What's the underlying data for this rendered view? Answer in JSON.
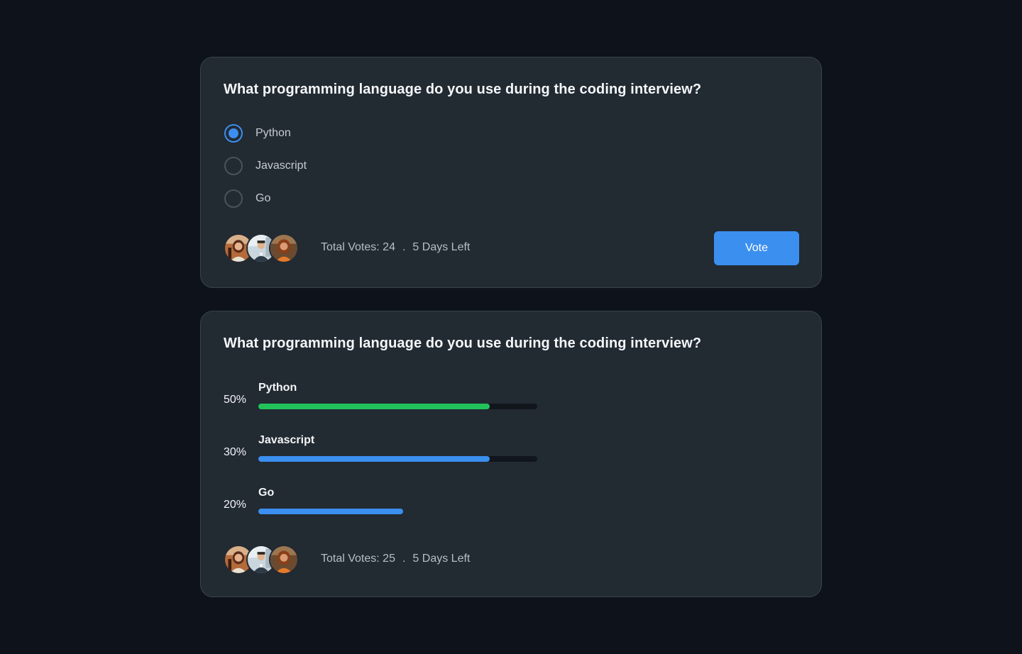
{
  "poll_vote": {
    "question": "What programming language do you use during the coding interview?",
    "options": [
      {
        "label": "Python",
        "selected": true
      },
      {
        "label": "Javascript",
        "selected": false
      },
      {
        "label": "Go",
        "selected": false
      }
    ],
    "total_votes": "Total Votes: 24",
    "separator": ".",
    "days_left": "5 Days Left",
    "vote_label": "Vote"
  },
  "poll_results": {
    "question": "What programming language do you use during the coding interview?",
    "results": [
      {
        "label": "Python",
        "percent_text": "50%",
        "bar_fill": 0.83,
        "color": "#22c25a"
      },
      {
        "label": "Javascript",
        "percent_text": "30%",
        "bar_fill": 0.83,
        "color": "#3b8fef"
      },
      {
        "label": "Go",
        "percent_text": "20%",
        "bar_fill": 0.52,
        "color": "#3b8fef",
        "track_visible": false
      }
    ],
    "total_votes": "Total Votes: 25",
    "separator": ".",
    "days_left": "5 Days Left"
  },
  "colors": {
    "background": "#0d121b",
    "card": "#222a32",
    "accent": "#3b8fef",
    "success": "#22c25a"
  },
  "icons": {
    "avatars": [
      "avatar-woman-1",
      "avatar-man",
      "avatar-woman-2"
    ]
  }
}
